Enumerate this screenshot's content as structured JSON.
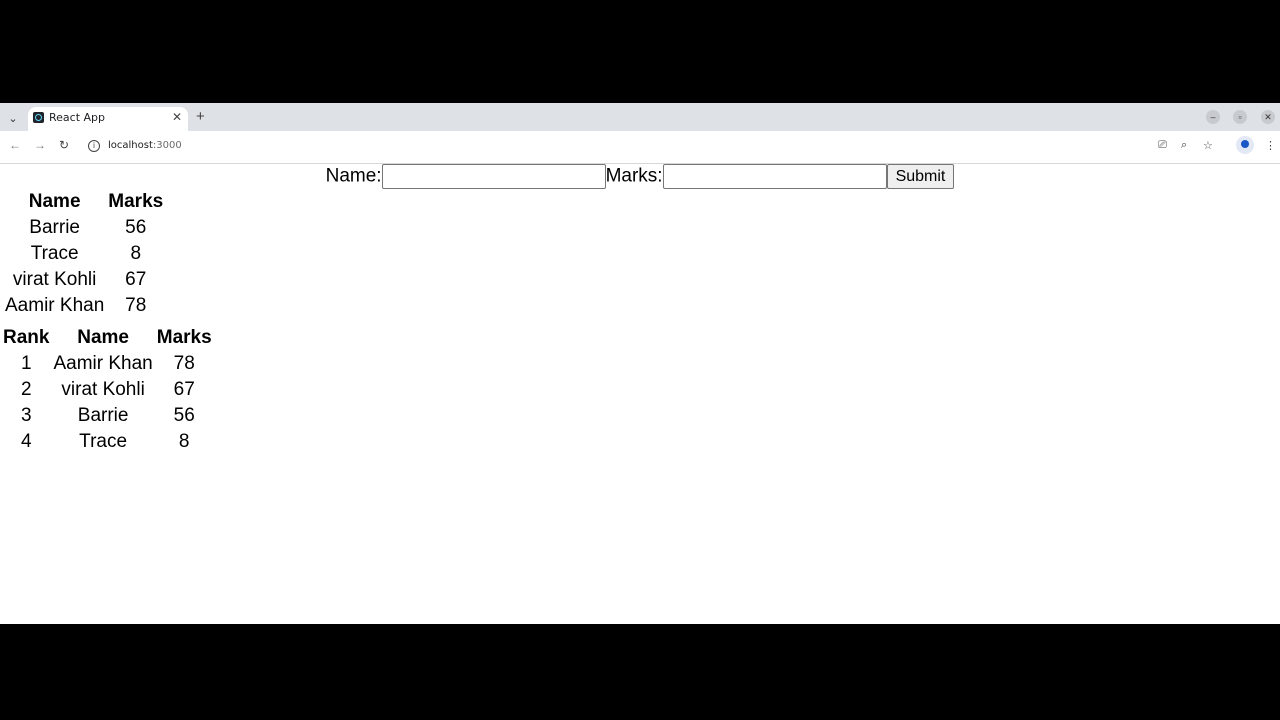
{
  "browser": {
    "tab_title": "React App",
    "url_host": "localhost",
    "url_port": ":3000"
  },
  "form": {
    "name_label": "Name:",
    "name_value": "",
    "marks_label": "Marks:",
    "marks_value": "",
    "submit_label": "Submit"
  },
  "entries_table": {
    "headers": [
      "Name",
      "Marks"
    ],
    "rows": [
      [
        "Barrie",
        "56"
      ],
      [
        "Trace",
        "8"
      ],
      [
        "virat Kohli",
        "67"
      ],
      [
        "Aamir Khan",
        "78"
      ]
    ]
  },
  "rank_table": {
    "headers": [
      "Rank",
      "Name",
      "Marks"
    ],
    "rows": [
      [
        "1",
        "Aamir Khan",
        "78"
      ],
      [
        "2",
        "virat Kohli",
        "67"
      ],
      [
        "3",
        "Barrie",
        "56"
      ],
      [
        "4",
        "Trace",
        "8"
      ]
    ]
  },
  "icons": {
    "favicon": "react-logo-icon",
    "tab_close": "close-icon",
    "new_tab": "plus-icon",
    "back": "back-arrow-icon",
    "forward": "forward-arrow-icon",
    "reload": "reload-icon",
    "site_info": "info-icon",
    "install": "install-app-icon",
    "zoom": "zoom-icon",
    "bookmark": "star-icon",
    "profile": "profile-icon",
    "menu": "kebab-menu-icon"
  }
}
